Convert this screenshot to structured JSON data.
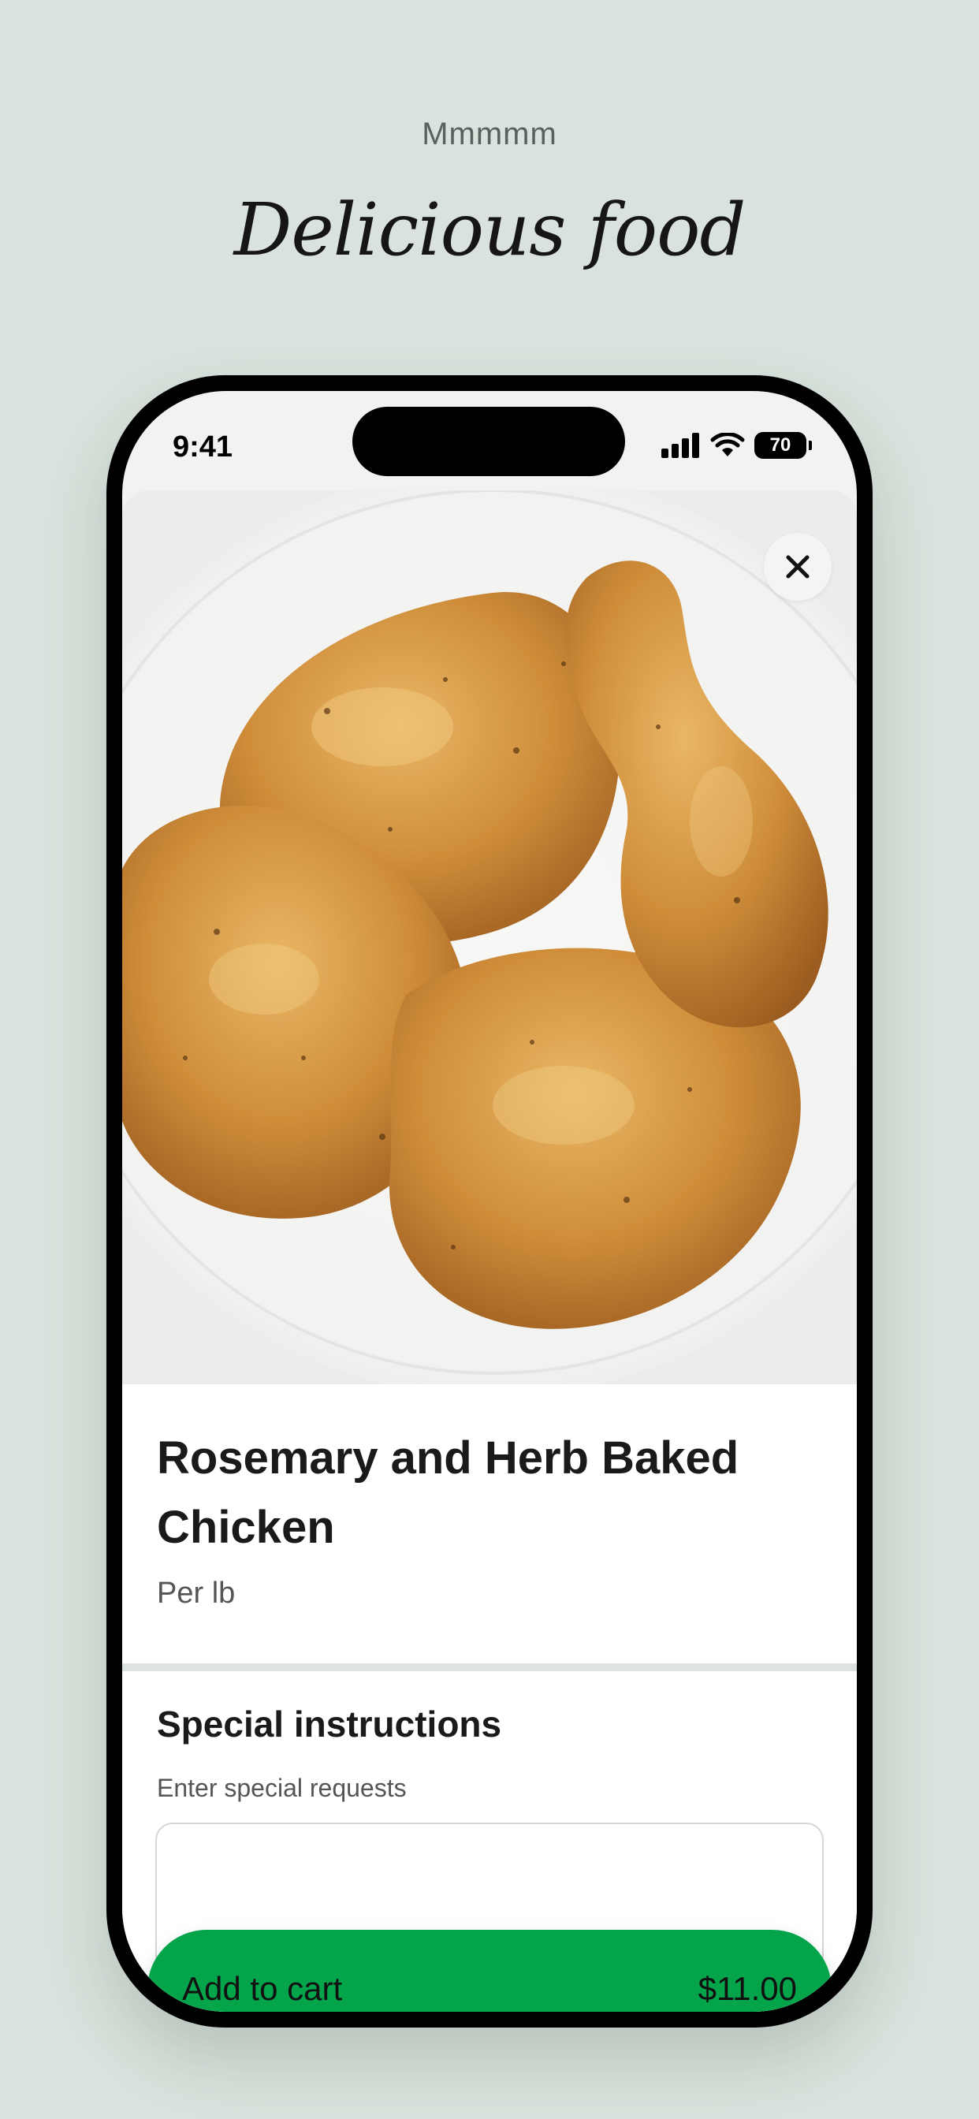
{
  "header": {
    "eyebrow": "Mmmmm",
    "title": "Delicious food"
  },
  "status_bar": {
    "time": "9:41",
    "battery": "70"
  },
  "product": {
    "image_alt": "Rosemary and herb baked chicken pieces on a white plate",
    "title": "Rosemary and Herb Baked Chicken",
    "unit": "Per lb"
  },
  "instructions": {
    "title": "Special instructions",
    "subtitle": "Enter special requests",
    "value": ""
  },
  "cart_button": {
    "label": "Add to cart",
    "price": "$11.00"
  },
  "colors": {
    "background": "#d9e2dc",
    "accent_green": "#04a44b",
    "text_primary": "#1a1a1a"
  },
  "icons": {
    "close": "close-icon",
    "signal": "cellular-signal-icon",
    "wifi": "wifi-icon",
    "battery": "battery-icon"
  }
}
